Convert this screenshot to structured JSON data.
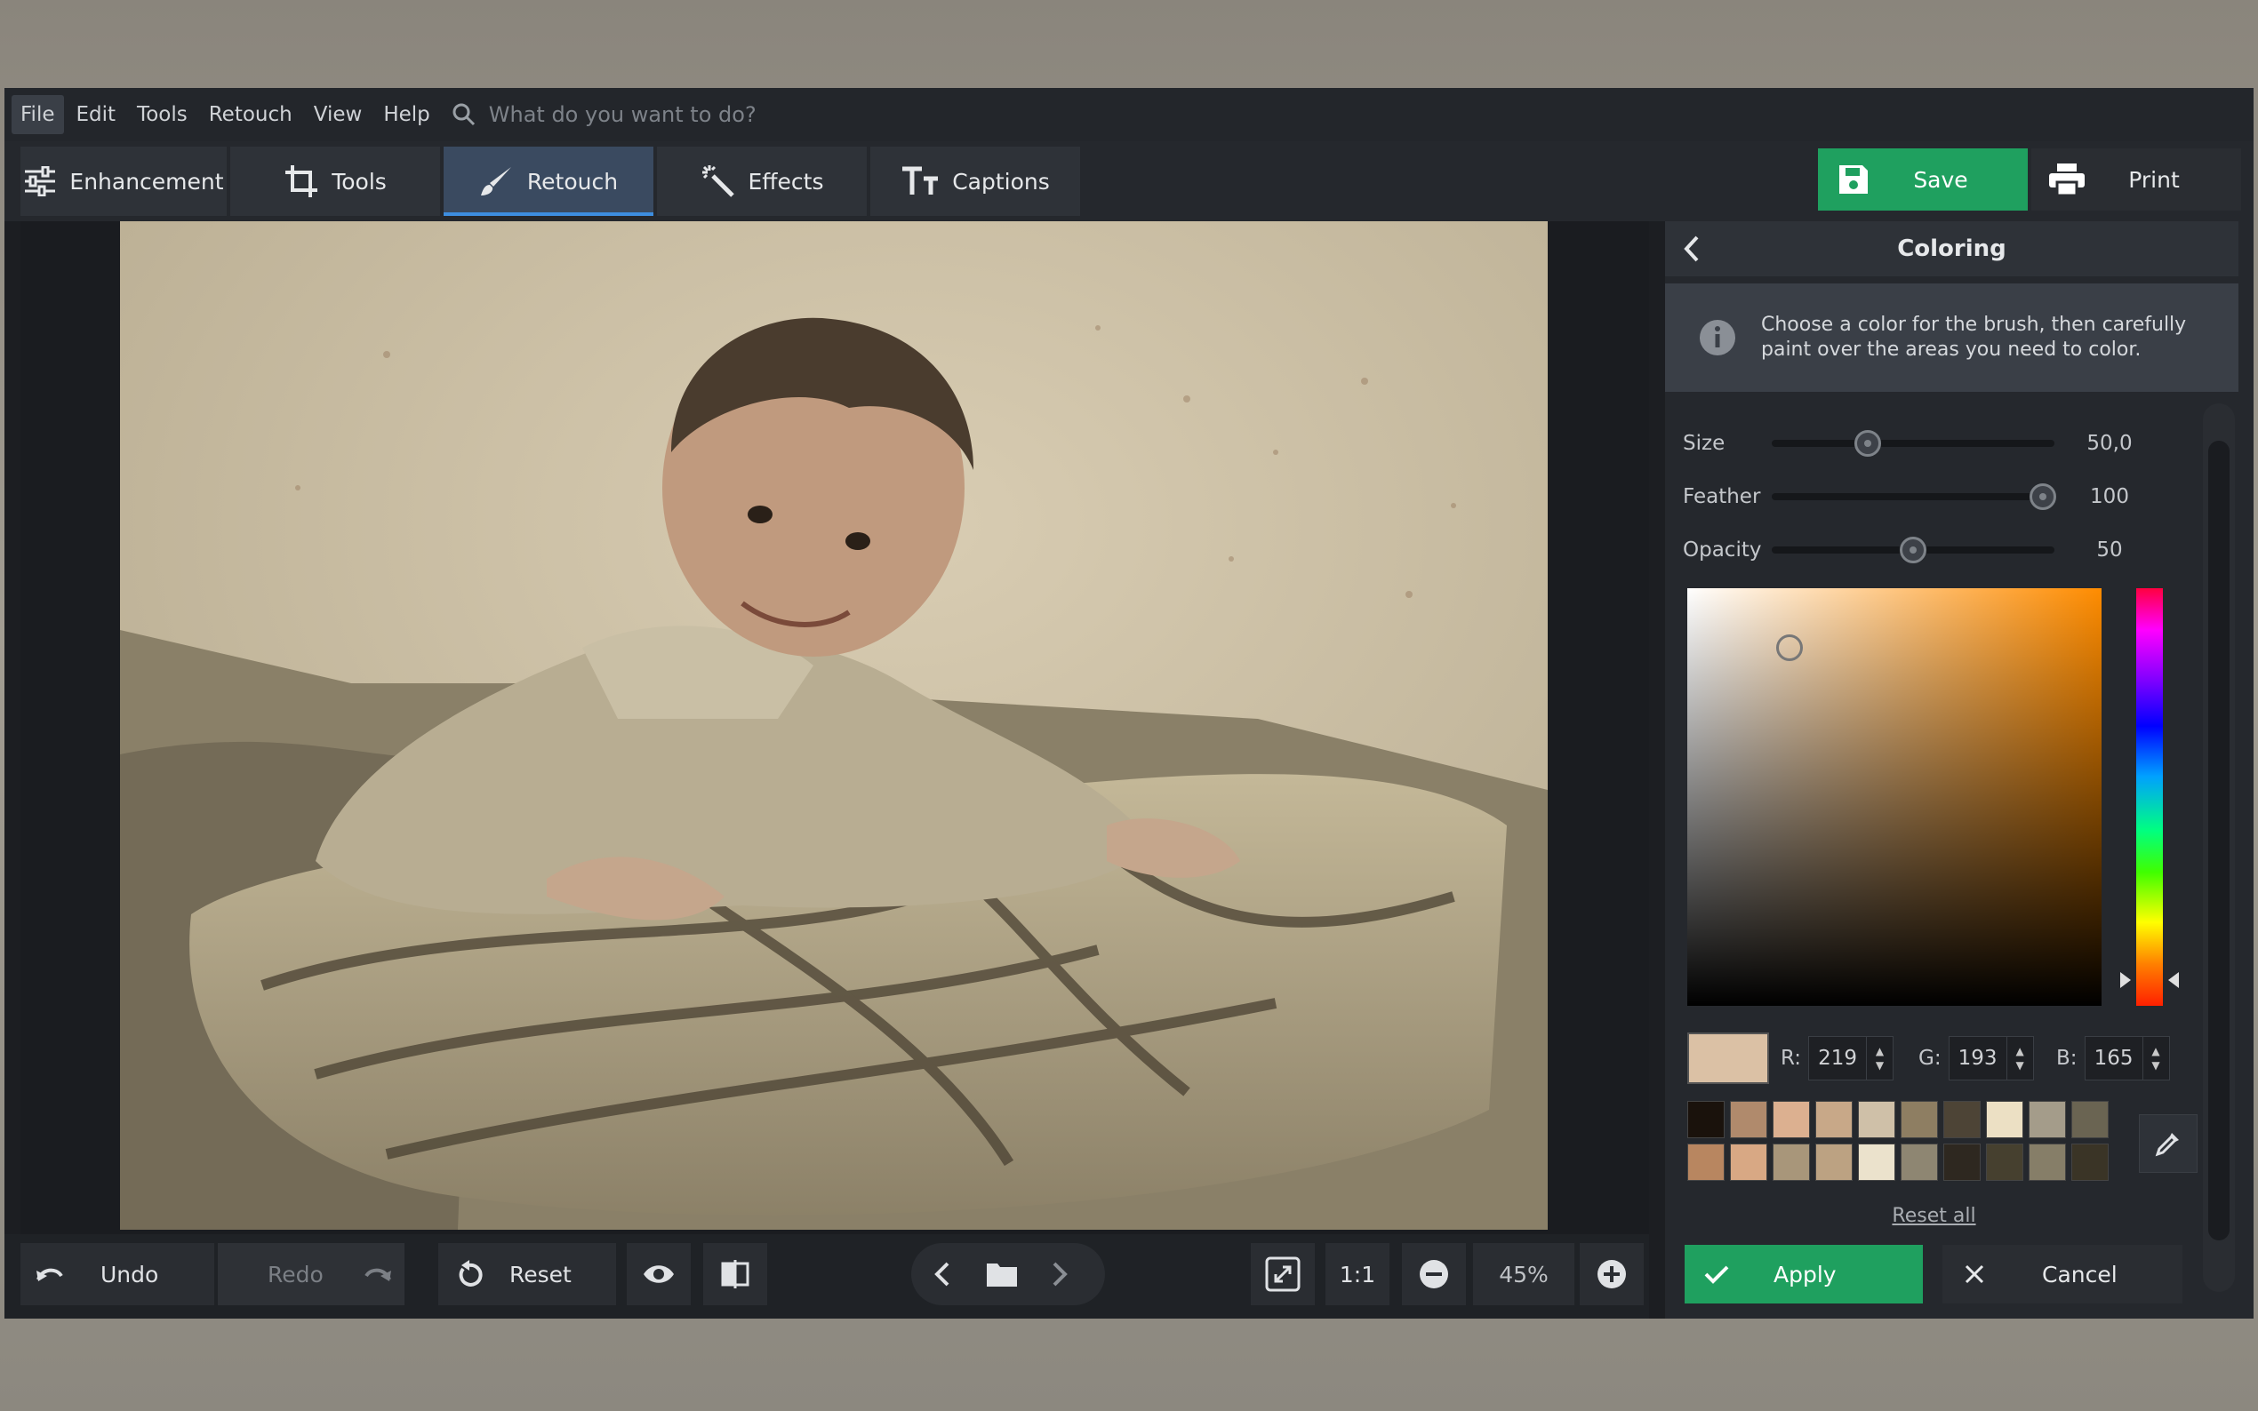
{
  "menubar": {
    "items": [
      "File",
      "Edit",
      "Tools",
      "Retouch",
      "View",
      "Help"
    ],
    "search_placeholder": "What do you want to do?"
  },
  "toolbar": {
    "tabs": [
      {
        "label": "Enhancement",
        "icon": "sliders-icon"
      },
      {
        "label": "Tools",
        "icon": "crop-icon"
      },
      {
        "label": "Retouch",
        "icon": "brush-icon",
        "active": true
      },
      {
        "label": "Effects",
        "icon": "magic-wand-icon"
      },
      {
        "label": "Captions",
        "icon": "text-icon"
      }
    ],
    "save_label": "Save",
    "print_label": "Print"
  },
  "bottombar": {
    "undo_label": "Undo",
    "redo_label": "Redo",
    "reset_label": "Reset",
    "one_to_one_label": "1:1",
    "zoom_value": "45%"
  },
  "panel": {
    "title": "Coloring",
    "info_text_line1": "Choose a color for the brush, then carefully",
    "info_text_line2": "paint over the areas you need to color.",
    "sliders": [
      {
        "label": "Size",
        "value": "50,0",
        "fraction": 0.34
      },
      {
        "label": "Feather",
        "value": "100",
        "fraction": 0.96
      },
      {
        "label": "Opacity",
        "value": "50",
        "fraction": 0.5
      }
    ],
    "rgb": {
      "r_label": "R:",
      "r": "219",
      "g_label": "G:",
      "g": "193",
      "b_label": "B:",
      "b": "165"
    },
    "current_color": "#dbc1a5",
    "swatches": [
      "#1a120c",
      "#b08a6c",
      "#dcb090",
      "#c8a888",
      "#cfc0a8",
      "#8e7e62",
      "#4d4436",
      "#ece0c4",
      "#a49c8a",
      "#6a6452",
      "#b88660",
      "#d8a884",
      "#a8967a",
      "#bca282",
      "#ebe2cc",
      "#8e8672",
      "#2e2820",
      "#46402f",
      "#867e68",
      "#3a3426"
    ],
    "reset_all_label": "Reset all",
    "apply_label": "Apply",
    "cancel_label": "Cancel"
  },
  "colors": {
    "accent_green": "#1fa05f",
    "active_tab": "#3a4a60",
    "active_tab_underline": "#3d8ee0"
  }
}
